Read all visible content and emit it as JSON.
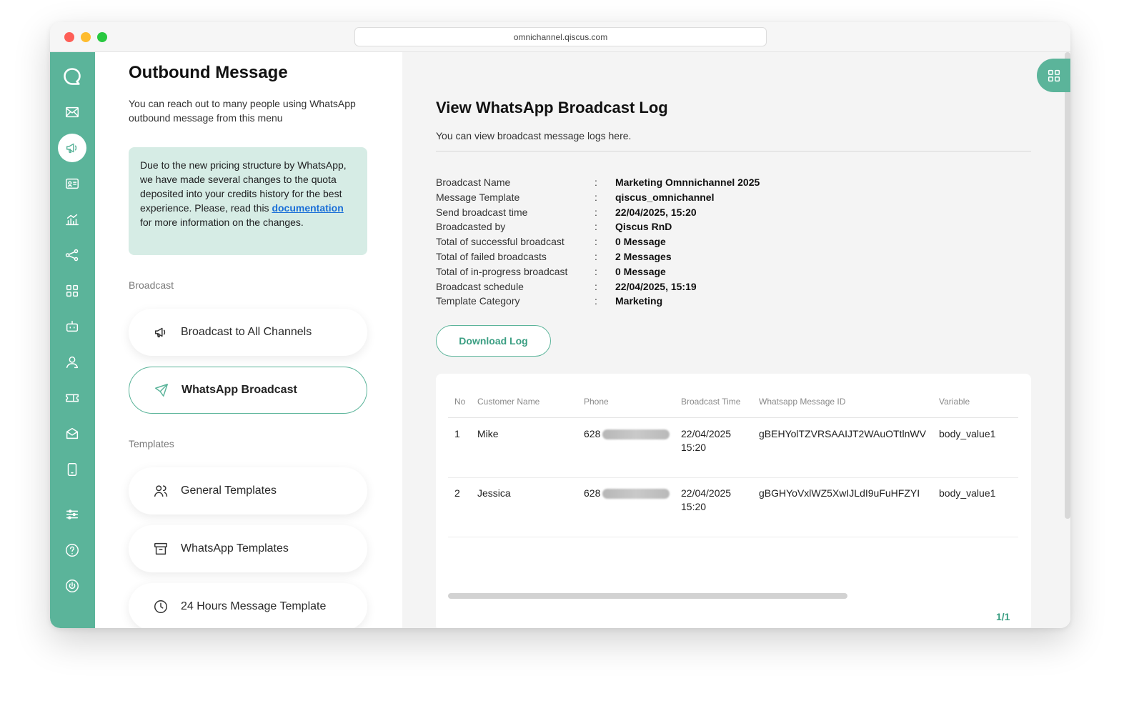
{
  "browser": {
    "url": "omnichannel.qiscus.com"
  },
  "sidebar": {
    "icons": [
      "chat-icon",
      "mail-icon",
      "megaphone-icon",
      "contact-card-icon",
      "analytics-icon",
      "flow-icon",
      "apps-icon",
      "bot-icon",
      "agent-icon",
      "ticket-icon",
      "inbox-icon",
      "mobile-icon",
      "settings-sliders-icon",
      "help-icon",
      "power-icon"
    ],
    "active": "megaphone-icon"
  },
  "left": {
    "title": "Outbound Message",
    "subtitle": "You can reach out to many people using WhatsApp outbound message from this menu",
    "notice_before": "Due to the new pricing structure by WhatsApp, we have made several changes to the quota deposited into your credits history for the best experience. Please, read this ",
    "notice_link": "documentation",
    "notice_after": " for more information on the changes.",
    "broadcast_label": "Broadcast",
    "broadcast_items": [
      {
        "label": "Broadcast to All Channels"
      },
      {
        "label": "WhatsApp Broadcast"
      }
    ],
    "templates_label": "Templates",
    "template_items": [
      {
        "label": "General Templates"
      },
      {
        "label": "WhatsApp Templates"
      },
      {
        "label": "24 Hours Message Template"
      }
    ]
  },
  "right": {
    "title": "View WhatsApp Broadcast Log",
    "subtitle": "You can view broadcast message logs here.",
    "separator": ":",
    "info": [
      {
        "label": "Broadcast Name",
        "value": "Marketing Omnnichannel 2025"
      },
      {
        "label": "Message Template",
        "value": "qiscus_omnichannel"
      },
      {
        "label": "Send broadcast time",
        "value": "22/04/2025, 15:20"
      },
      {
        "label": "Broadcasted by",
        "value": "Qiscus RnD"
      },
      {
        "label": "Total of successful broadcast",
        "value": "0 Message"
      },
      {
        "label": "Total of failed broadcasts",
        "value": "2 Messages"
      },
      {
        "label": "Total of in-progress broadcast",
        "value": "0 Message"
      },
      {
        "label": "Broadcast schedule",
        "value": "22/04/2025, 15:19"
      },
      {
        "label": "Template Category",
        "value": "Marketing"
      }
    ],
    "download_label": "Download Log",
    "table": {
      "headers": [
        "No",
        "Customer Name",
        "Phone",
        "Broadcast Time",
        "Whatsapp Message ID",
        "Variable"
      ],
      "rows": [
        {
          "no": "1",
          "name": "Mike",
          "phone": "628",
          "date": "22/04/2025",
          "time": "15:20",
          "msg_id": "gBEHYolTZVRSAAIJT2WAuOTtlnWV",
          "variable": "body_value1"
        },
        {
          "no": "2",
          "name": "Jessica",
          "phone": "628",
          "date": "22/04/2025",
          "time": "15:20",
          "msg_id": "gBGHYoVxlWZ5XwIJLdI9uFuHFZYI",
          "variable": "body_value1"
        }
      ]
    },
    "pager": "1/1"
  }
}
